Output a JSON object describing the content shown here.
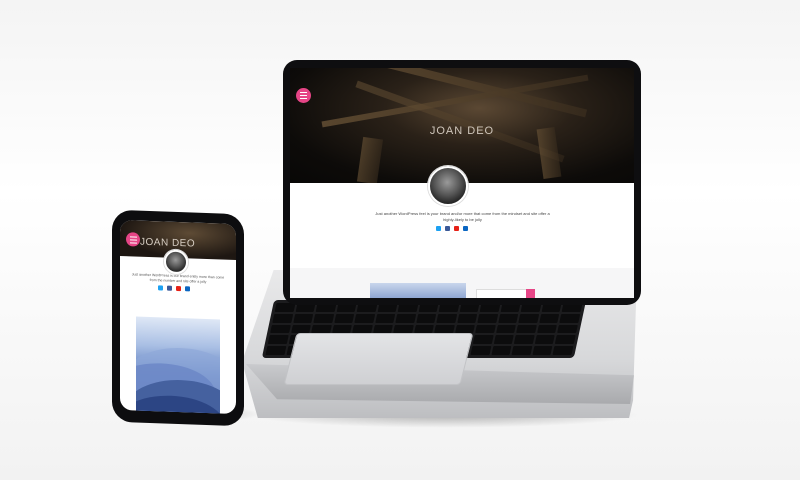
{
  "site": {
    "name": "JOAN DEO",
    "bio": "Just another WordPress feel is your brand and/or more that come from the mindset and site offer a highly-likely to be jolly",
    "phone_bio": "Just another WordPress is our brand entity more than come from the number and site offer a jolly",
    "social_icons": [
      "twitter-icon",
      "facebook-icon",
      "youtube-icon",
      "linkedin-icon"
    ]
  },
  "colors": {
    "accent": "#e64586",
    "twitter": "#1da1f2",
    "facebook": "#3b5998",
    "youtube": "#e62117",
    "linkedin": "#0a66c2"
  }
}
